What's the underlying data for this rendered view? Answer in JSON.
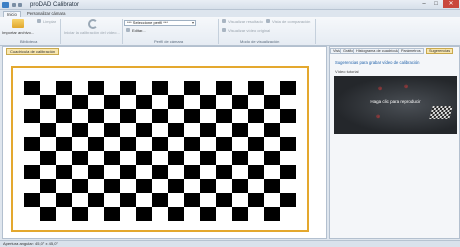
{
  "window": {
    "title": "proDAD Calibrator",
    "buttons": {
      "minimize": "–",
      "maximize": "□",
      "close": "✕"
    }
  },
  "ribbon_tabs": [
    {
      "label": "Inicio",
      "active": true
    },
    {
      "label": "Personalizar cámara",
      "active": false
    }
  ],
  "ribbon": {
    "import_label": "Importar archivo...",
    "remove_label": "Limpiar",
    "reset_calibration_label": "Iniciar la calibración del vídeo...",
    "profile_select_value": "*** Seleccione perfil ***",
    "edit_label": "Editar...",
    "view_result_label": "Visualizar resultado",
    "view_original_label": "Visualizar vídeo original",
    "view_preview_label": "Vista de comparación",
    "groups": {
      "biblioteca": "Biblioteca",
      "perfil": "Perfil de cámara",
      "modo": "Modo de visualización"
    }
  },
  "left_panel": {
    "tab_label": "Cuadrícula de calibración"
  },
  "checkerboard": {
    "rows": 10,
    "cols": 17,
    "dark": "#000000",
    "light": "#ffffff",
    "frame_color": "#e4a82e"
  },
  "right_panel": {
    "tabs": [
      "Vista",
      "Gráfico",
      "Histograma de cuadrícula",
      "Parámetros",
      "Sugerencias"
    ],
    "active_tab": "Sugerencias",
    "header": "Sugerencias para grabar vídeo de calibración",
    "video_label": "Vídeo tutorial",
    "play_text": "Haga clic para reproducir"
  },
  "status": {
    "text": "Apertura angular: 45,0° x 45,0°"
  }
}
